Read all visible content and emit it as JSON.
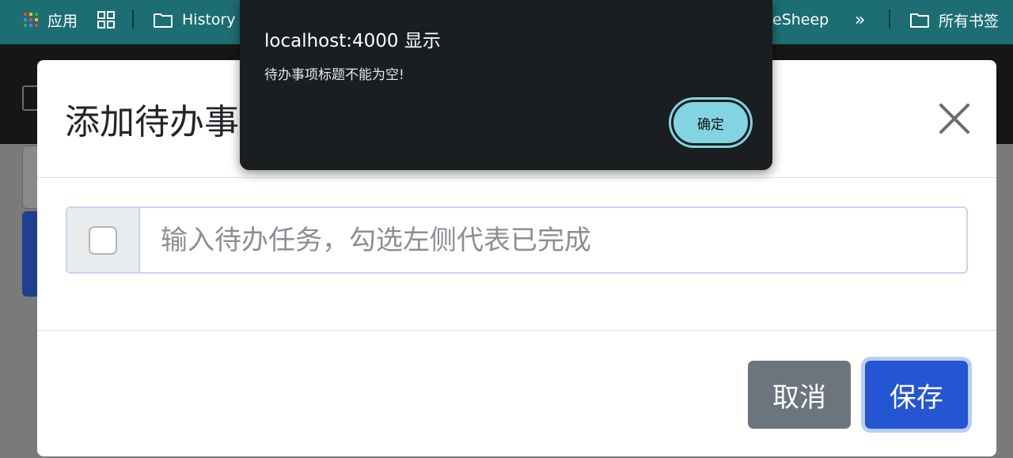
{
  "bookmarks": {
    "apps_label": "应用",
    "history_label": "History",
    "partial_label": "eSheep",
    "more_label": "»",
    "all_bookmarks_label": "所有书签"
  },
  "modal": {
    "title": "添加待办事",
    "input_placeholder": "输入待办任务，勾选左侧代表已完成",
    "cancel_label": "取消",
    "save_label": "保存"
  },
  "alert": {
    "title": "localhost:4000 显示",
    "message": "待办事项标题不能为空!",
    "ok_label": "确定"
  },
  "colors": {
    "bookmarks_bar": "#1d6e73",
    "save_button": "#2456d3",
    "cancel_button": "#6c757d",
    "alert_background": "#1a1e21",
    "alert_button": "#83d4e2"
  }
}
